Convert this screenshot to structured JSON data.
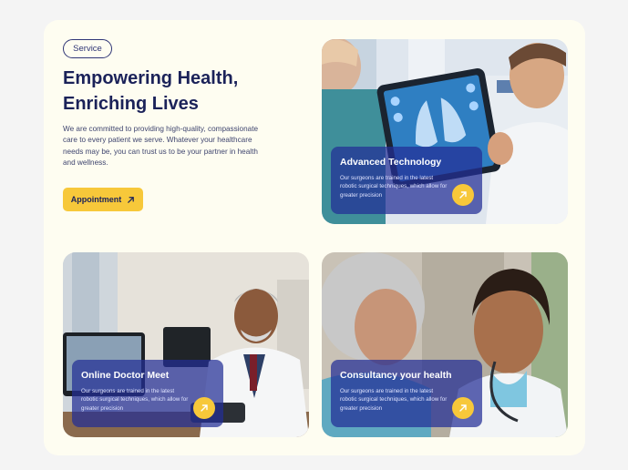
{
  "hero": {
    "tag": "Service",
    "headline_line1": "Empowering Health,",
    "headline_line2": "Enriching Lives",
    "description": "We are committed to providing high-quality, compassionate care to every patient we serve. Whatever your healthcare needs may be, you can trust us to be your partner in health and wellness.",
    "cta_label": "Appointment",
    "cta_icon": "arrow-up-right-icon"
  },
  "cards": [
    {
      "title": "Advanced Technology",
      "body": "Our surgeons are trained in the latest robotic surgical techniques, which allow for greater precision",
      "icon": "arrow-up-right-icon"
    },
    {
      "title": "Online Doctor Meet",
      "body": "Our surgeons are trained in the latest robotic surgical techniques, which allow for greater precision",
      "icon": "arrow-up-right-icon"
    },
    {
      "title": "Consultancy your health",
      "body": "Our surgeons are trained in the latest robotic surgical techniques, which allow for greater precision",
      "icon": "arrow-up-right-icon"
    }
  ],
  "colors": {
    "navy": "#1b2259",
    "accent_yellow": "#f7c83a",
    "panel_background": "#fefdf1",
    "overlay_blue": "#222e96"
  }
}
